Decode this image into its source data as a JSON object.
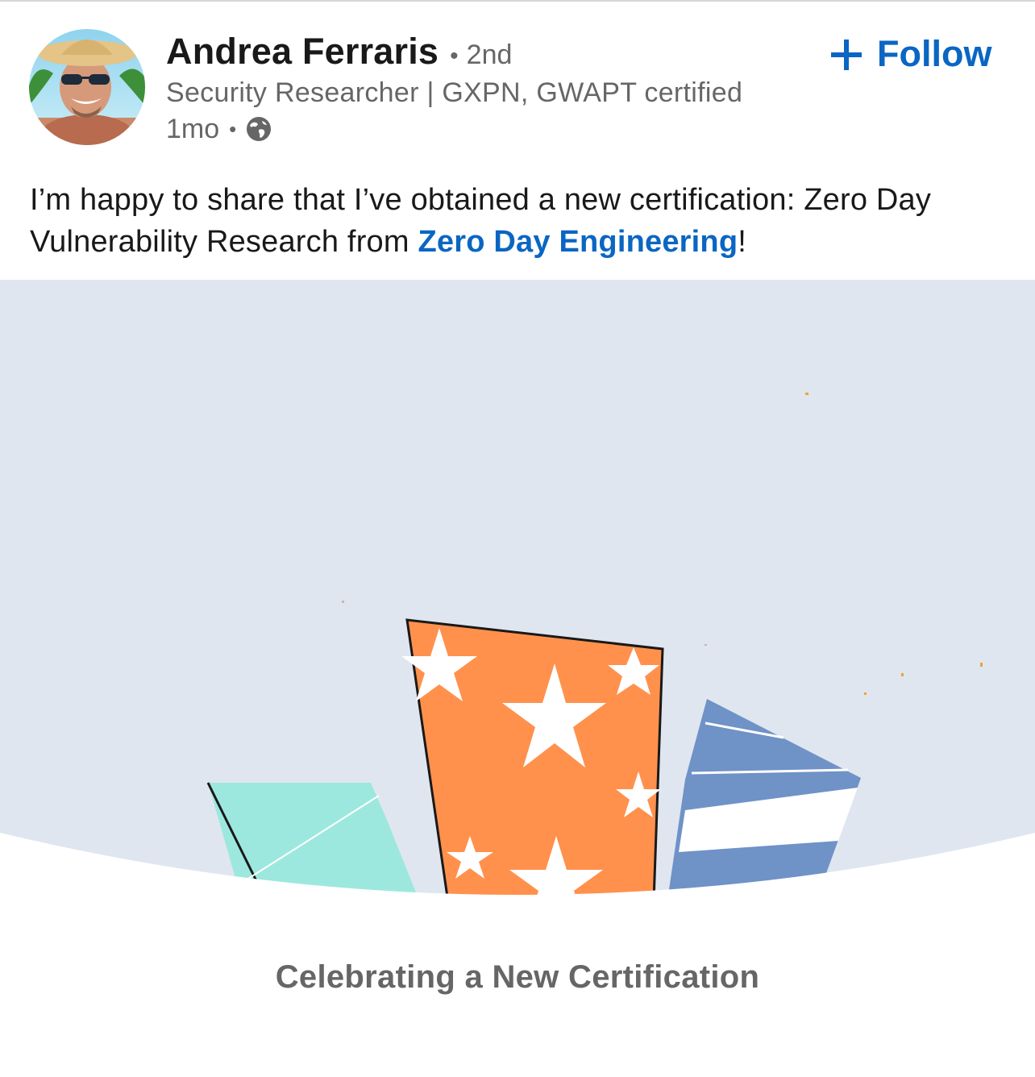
{
  "author": {
    "name": "Andrea Ferraris",
    "separator": "•",
    "degree": "2nd",
    "headline": "Security Researcher | GXPN, GWAPT certified",
    "avatar_icon": "profile-photo"
  },
  "meta": {
    "age": "1mo",
    "separator": "•",
    "visibility_icon": "globe-icon"
  },
  "follow": {
    "icon": "plus-icon",
    "label": "Follow"
  },
  "post": {
    "text_before": "I’m happy to share that I’ve obtained a new certification: Zero Day Vulnerability Research from ",
    "link_text": "Zero Day Engineering",
    "text_after": "!"
  },
  "banner": {
    "caption": "Celebrating a New Certification",
    "background_color": "#e0e6ef",
    "colors": {
      "orange": "#ff914d",
      "teal": "#9de8de",
      "blue": "#6f92c7"
    }
  },
  "colors": {
    "link": "#0a66c2",
    "text": "#191919",
    "muted": "#666666"
  }
}
